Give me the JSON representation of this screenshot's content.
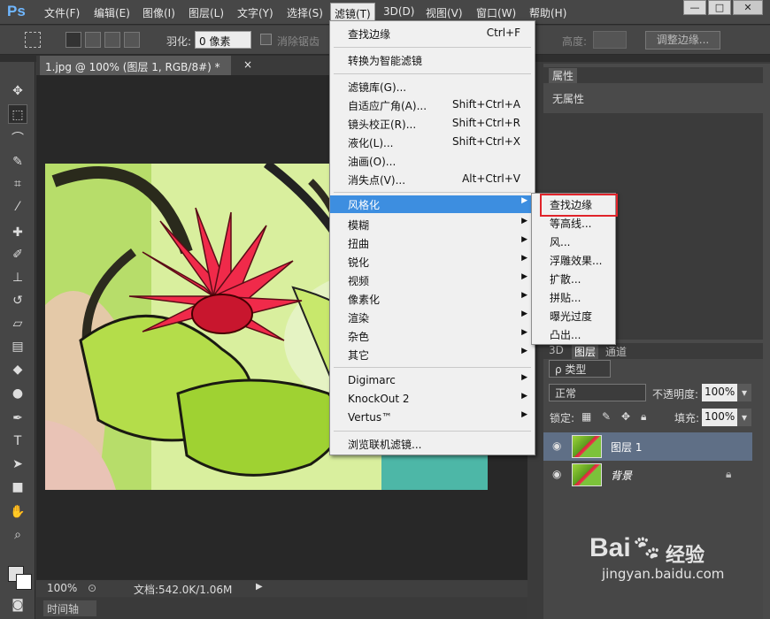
{
  "app": {
    "logo": "Ps"
  },
  "menubar": {
    "items": [
      "文件(F)",
      "编辑(E)",
      "图像(I)",
      "图层(L)",
      "文字(Y)",
      "选择(S)",
      "滤镜(T)",
      "3D(D)",
      "视图(V)",
      "窗口(W)",
      "帮助(H)"
    ],
    "active": "滤镜(T)"
  },
  "window_buttons": {
    "minimize": "—",
    "maximize": "□",
    "close": "✕"
  },
  "options": {
    "feather_label": "羽化:",
    "feather_value": "0 像素",
    "antialias_label": "消除锯齿",
    "height_label": "高度:",
    "refine_label": "调整边缘..."
  },
  "document": {
    "tab_title": "1.jpg @ 100% (图层 1, RGB/8#) *",
    "tab_close": "×"
  },
  "status": {
    "zoom": "100%",
    "doc_size": "文档:542.0K/1.06M"
  },
  "timeline_label": "时间轴",
  "filter_menu": {
    "items": [
      {
        "label": "查找边缘",
        "shortcut": "Ctrl+F"
      },
      {
        "label": "转换为智能滤镜"
      },
      {
        "label": "滤镜库(G)..."
      },
      {
        "label": "自适应广角(A)...",
        "shortcut": "Shift+Ctrl+A"
      },
      {
        "label": "镜头校正(R)...",
        "shortcut": "Shift+Ctrl+R"
      },
      {
        "label": "液化(L)...",
        "shortcut": "Shift+Ctrl+X"
      },
      {
        "label": "油画(O)..."
      },
      {
        "label": "消失点(V)...",
        "shortcut": "Alt+Ctrl+V"
      },
      {
        "label": "风格化",
        "submenu": true,
        "highlighted": true
      },
      {
        "label": "模糊",
        "submenu": true
      },
      {
        "label": "扭曲",
        "submenu": true
      },
      {
        "label": "锐化",
        "submenu": true
      },
      {
        "label": "视频",
        "submenu": true
      },
      {
        "label": "像素化",
        "submenu": true
      },
      {
        "label": "渲染",
        "submenu": true
      },
      {
        "label": "杂色",
        "submenu": true
      },
      {
        "label": "其它",
        "submenu": true
      },
      {
        "label": "Digimarc",
        "submenu": true
      },
      {
        "label": "KnockOut 2",
        "submenu": true
      },
      {
        "label": "Vertus™",
        "submenu": true
      },
      {
        "label": "浏览联机滤镜..."
      }
    ]
  },
  "stylize_submenu": {
    "items": [
      "查找边缘",
      "等高线...",
      "风...",
      "浮雕效果...",
      "扩散...",
      "拼贴...",
      "曝光过度",
      "凸出..."
    ]
  },
  "properties": {
    "tab": "属性",
    "empty_text": "无属性"
  },
  "layers_panel": {
    "tabs": [
      "3D",
      "图层",
      "通道"
    ],
    "kind_filter": "ρ 类型",
    "blend_mode": "正常",
    "opacity_label": "不透明度:",
    "opacity_value": "100%",
    "lock_label": "锁定:",
    "fill_label": "填充:",
    "fill_value": "100%",
    "layers": [
      {
        "name": "图层 1",
        "selected": true
      },
      {
        "name": "背景",
        "locked": true
      }
    ]
  },
  "watermark": {
    "logo": "Bai",
    "suffix": "经验",
    "url": "jingyan.baidu.com"
  },
  "colors": {
    "accent": "#3d8ee0",
    "highlight_box": "#e0232a",
    "flower": "#e8263c",
    "leaf": "#8fd13a"
  }
}
